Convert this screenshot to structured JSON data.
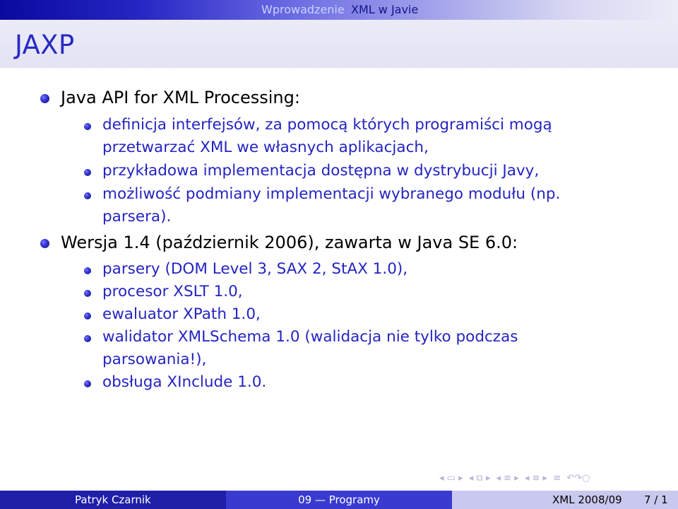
{
  "nav": {
    "tabs": [
      {
        "label": "Wprowadzenie",
        "active": false
      },
      {
        "label": "XML w Javie",
        "active": true
      }
    ]
  },
  "slide": {
    "title": "JAXP",
    "items": [
      {
        "text": "Java API for XML Processing:",
        "subitems": [
          {
            "lines": [
              "definicja interfejsów, za pomocą których programiści mogą",
              "przetwarzać XML we własnych aplikacjach,"
            ]
          },
          {
            "lines": [
              "przykładowa implementacja dostępna w dystrybucji Javy,"
            ]
          },
          {
            "lines": [
              "możliwość podmiany implementacji wybranego modułu (np.",
              "parsera)."
            ]
          }
        ]
      },
      {
        "text": "Wersja 1.4 (październik 2006), zawarta w Java SE 6.0:",
        "subitems": [
          {
            "lines": [
              "parsery (DOM Level 3, SAX 2, StAX 1.0),"
            ]
          },
          {
            "lines": [
              "procesor XSLT 1.0,"
            ]
          },
          {
            "lines": [
              "ewaluator XPath 1.0,"
            ]
          },
          {
            "lines": [
              "walidator XMLSchema 1.0 (walidacja nie tylko podczas",
              "parsowania!),"
            ]
          },
          {
            "lines": [
              "obsługa XInclude 1.0."
            ]
          }
        ]
      }
    ]
  },
  "footer": {
    "author": "Patryk Czarnik",
    "lecture": "09 — Programy",
    "course": "XML 2008/09",
    "page": "7 / 1"
  },
  "beamer_nav_icons": [
    "nav-first-icon",
    "nav-frame-icon",
    "nav-prev-icon",
    "nav-subsection-icon",
    "nav-section-icon",
    "nav-next-icon",
    "nav-align-icon",
    "nav-search-icon"
  ],
  "colors": {
    "accent": "#2929c4",
    "footer_dark": "#1f1fa8",
    "footer_mid": "#3a3ad0",
    "footer_light": "#c9c9ef"
  }
}
